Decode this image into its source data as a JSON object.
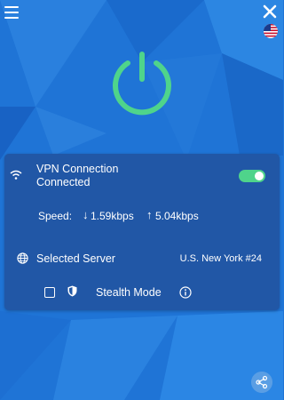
{
  "colors": {
    "accent": "#4fd48b",
    "background": "#1f74d6",
    "panel": "#2157a6"
  },
  "header": {
    "menu_icon": "hamburger-icon",
    "close_icon": "close-icon",
    "flag_icon": "us-flag-icon"
  },
  "power": {
    "icon": "power-icon",
    "state": "on"
  },
  "connection": {
    "title": "VPN Connection",
    "status": "Connected",
    "toggle_on": true
  },
  "speed": {
    "label": "Speed:",
    "down_arrow": "↓",
    "download": "1.59kbps",
    "up_arrow": "↑",
    "upload": "5.04kbps"
  },
  "server": {
    "label": "Selected Server",
    "value": "U.S. New York #24"
  },
  "stealth": {
    "label": "Stealth Mode",
    "checked": false,
    "shield_icon": "shield-icon",
    "info_icon": "info-icon"
  },
  "footer": {
    "share_icon": "share-icon"
  }
}
